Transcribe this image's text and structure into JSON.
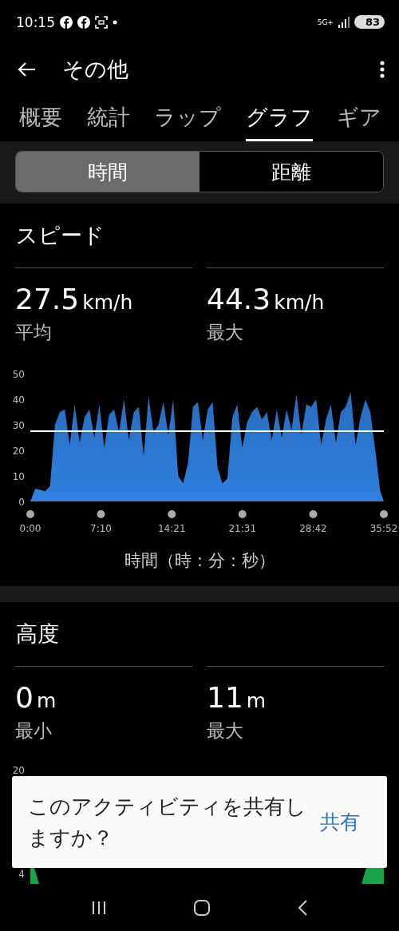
{
  "status_bar": {
    "time": "10:15",
    "network": "5G+",
    "battery": "83"
  },
  "app_bar": {
    "title": "その他"
  },
  "tabs": [
    {
      "label": "概要",
      "selected": false
    },
    {
      "label": "統計",
      "selected": false
    },
    {
      "label": "ラップ",
      "selected": false
    },
    {
      "label": "グラフ",
      "selected": true
    },
    {
      "label": "ギア",
      "selected": false
    }
  ],
  "segmented": [
    {
      "label": "時間",
      "selected": true
    },
    {
      "label": "距離",
      "selected": false
    }
  ],
  "sections": [
    {
      "title": "スピード",
      "stats": [
        {
          "value": "27.5",
          "unit": "km/h",
          "label": "平均"
        },
        {
          "value": "44.3",
          "unit": "km/h",
          "label": "最大"
        }
      ],
      "chart_data": {
        "type": "area",
        "xlabel": "時間（時：分：秒）",
        "xlim": [
          0,
          2152
        ],
        "ylim": [
          0,
          50
        ],
        "yticks": [
          0,
          10,
          20,
          30,
          40,
          50
        ],
        "xticks": [
          {
            "value": 0,
            "label": "0:00"
          },
          {
            "value": 430,
            "label": "7:10"
          },
          {
            "value": 861,
            "label": "14:21"
          },
          {
            "value": 1291,
            "label": "21:31"
          },
          {
            "value": 1722,
            "label": "28:42"
          },
          {
            "value": 2152,
            "label": "35:52"
          }
        ],
        "x": [
          0,
          30,
          60,
          90,
          120,
          150,
          180,
          210,
          240,
          270,
          300,
          330,
          360,
          390,
          420,
          450,
          480,
          510,
          540,
          570,
          600,
          630,
          660,
          690,
          720,
          750,
          780,
          810,
          840,
          870,
          900,
          930,
          960,
          990,
          1020,
          1050,
          1080,
          1110,
          1140,
          1170,
          1200,
          1230,
          1260,
          1290,
          1320,
          1350,
          1380,
          1410,
          1440,
          1470,
          1500,
          1530,
          1560,
          1590,
          1620,
          1650,
          1680,
          1710,
          1740,
          1770,
          1800,
          1830,
          1860,
          1890,
          1920,
          1950,
          1980,
          2010,
          2040,
          2070,
          2100,
          2130,
          2152
        ],
        "series": [
          {
            "color": "#2f80e0",
            "values": [
              0,
              5,
              4.5,
              4,
              6,
              30,
              35,
              36,
              22,
              38,
              23,
              33,
              36,
              25,
              38,
              21,
              34,
              36,
              27,
              40,
              24,
              35,
              37,
              18,
              41,
              27,
              30,
              39,
              26,
              40,
              10,
              7,
              15,
              37,
              39,
              24,
              36,
              39,
              13,
              7,
              9,
              33,
              38,
              21,
              31,
              35,
              37,
              32,
              35,
              24,
              36,
              25,
              36,
              28,
              42,
              26,
              38,
              37,
              40,
              22,
              32,
              38,
              23,
              35,
              37,
              43,
              22,
              33,
              40,
              35,
              20,
              4,
              0
            ]
          },
          {
            "type": "line",
            "color": "#ffffff",
            "values": [
              27.5,
              27.5,
              27.5,
              27.5,
              27.5,
              27.5,
              27.5,
              27.5,
              27.5,
              27.5,
              27.5,
              27.5,
              27.5,
              27.5,
              27.5,
              27.5,
              27.5,
              27.5,
              27.5,
              27.5,
              27.5,
              27.5,
              27.5,
              27.5,
              27.5,
              27.5,
              27.5,
              27.5,
              27.5,
              27.5,
              27.5,
              27.5,
              27.5,
              27.5,
              27.5,
              27.5,
              27.5,
              27.5,
              27.5,
              27.5,
              27.5,
              27.5,
              27.5,
              27.5,
              27.5,
              27.5,
              27.5,
              27.5,
              27.5,
              27.5,
              27.5,
              27.5,
              27.5,
              27.5,
              27.5,
              27.5,
              27.5,
              27.5,
              27.5,
              27.5,
              27.5,
              27.5,
              27.5,
              27.5,
              27.5,
              27.5,
              27.5,
              27.5,
              27.5,
              27.5,
              27.5,
              27.5,
              27.5
            ]
          }
        ]
      }
    },
    {
      "title": "高度",
      "stats": [
        {
          "value": "0",
          "unit": "m",
          "label": "最小"
        },
        {
          "value": "11",
          "unit": "m",
          "label": "最大"
        }
      ],
      "chart": {
        "axis_labels": [
          "20",
          "4"
        ]
      }
    }
  ],
  "snackbar": {
    "message": "このアクティビティを共有しますか？",
    "action": "共有"
  }
}
